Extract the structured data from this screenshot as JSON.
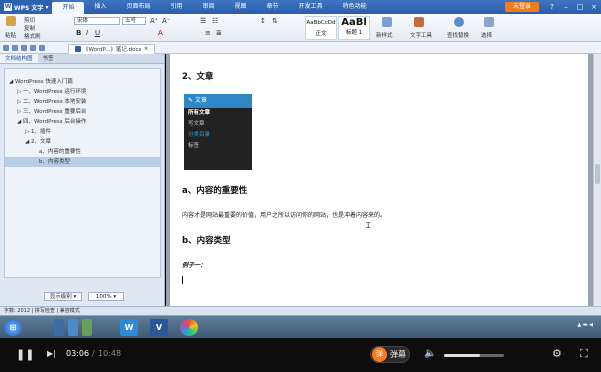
{
  "titlebar": {
    "app": "WPS 文字",
    "tabs": [
      "开始",
      "插入",
      "页面布局",
      "引用",
      "审阅",
      "视图",
      "章节",
      "开发工具",
      "特色功能"
    ],
    "active_tab": "开始",
    "account_btn": "未登录"
  },
  "ribbon": {
    "paste": "粘贴",
    "cut": "剪切",
    "copy": "复制",
    "format_painter": "格式刷",
    "font": "宋体",
    "size": "五号",
    "style1": "AaBbCcDd",
    "style1_name": "正文",
    "style2": "AaBl",
    "style2_name": "标题 1",
    "new_style": "新样式",
    "text_tools": "文字工具",
    "find_replace": "查找替换",
    "select": "选择"
  },
  "qbar": {
    "doc_tab": "《WordP...》笔记.docx"
  },
  "nav": {
    "tabs": [
      "文档结构图",
      "书签"
    ],
    "items": [
      "WordPress 快速入门篇",
      "一、WordPress 运行环境",
      "二、WordPress 本地安装",
      "三、WordPress 重要后台",
      "四、WordPress 后台操作",
      "1、插件",
      "2、文章",
      "a、内容的重要性",
      "b、内容类型"
    ],
    "show_level": "显示级别",
    "zoom": "100%"
  },
  "doc": {
    "h_article": "2、文章",
    "wp_menu": {
      "header": "文章",
      "items": [
        "所有文章",
        "写文章",
        "分类目录",
        "标签"
      ]
    },
    "h_importance": "a、内容的重要性",
    "para1": "内容才是网站最重要的价值，用户之所以访问你的网站，也是冲着内容来的。",
    "h_types": "b、内容类型",
    "example": "例子一："
  },
  "status": {
    "text": "字数: 2012  |  拼写检查  |  兼容模式"
  },
  "player": {
    "time_current": "03:06",
    "time_total": "10:48",
    "danmu_label": "弹幕",
    "danmu_toggle": "弹",
    "volume": 0.6
  }
}
